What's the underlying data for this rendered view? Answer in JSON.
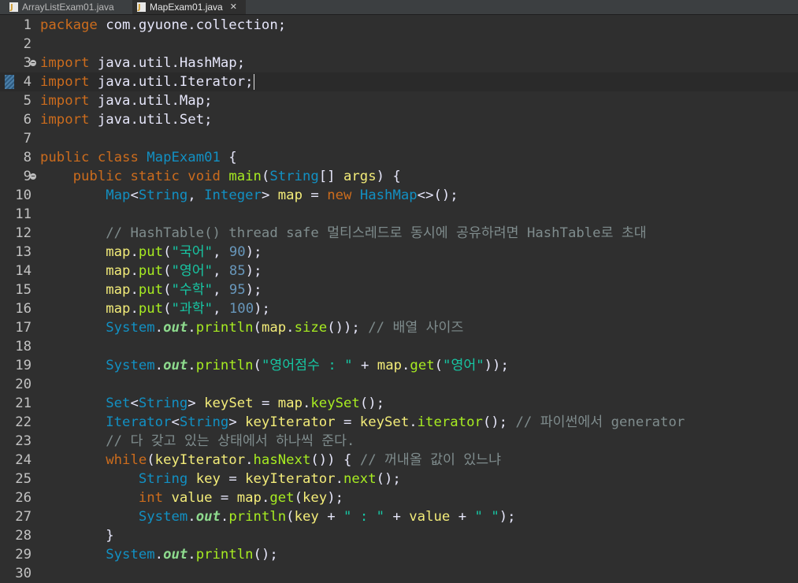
{
  "tabs": [
    {
      "label": "ArrayListExam01.java",
      "active": false
    },
    {
      "label": "MapExam01.java",
      "active": true,
      "close": "✕"
    }
  ],
  "cursor_line": 4,
  "folds": [
    3,
    9
  ],
  "lines": [
    {
      "n": "1",
      "t": [
        [
          "kw",
          "package"
        ],
        [
          "pl",
          " com.gyuone.collection;"
        ]
      ]
    },
    {
      "n": "2",
      "t": []
    },
    {
      "n": "3",
      "t": [
        [
          "kw",
          "import"
        ],
        [
          "pl",
          " java.util.HashMap;"
        ]
      ]
    },
    {
      "n": "4",
      "t": [
        [
          "kw",
          "import"
        ],
        [
          "pl",
          " java.util.Iterator;"
        ]
      ]
    },
    {
      "n": "5",
      "t": [
        [
          "kw",
          "import"
        ],
        [
          "pl",
          " java.util.Map;"
        ]
      ]
    },
    {
      "n": "6",
      "t": [
        [
          "kw",
          "import"
        ],
        [
          "pl",
          " java.util.Set;"
        ]
      ]
    },
    {
      "n": "7",
      "t": []
    },
    {
      "n": "8",
      "t": [
        [
          "kw",
          "public class "
        ],
        [
          "cls",
          "MapExam01"
        ],
        [
          "pl",
          " {"
        ]
      ]
    },
    {
      "n": "9",
      "t": [
        [
          "pl",
          "    "
        ],
        [
          "kw",
          "public static void "
        ],
        [
          "meth",
          "main"
        ],
        [
          "pl",
          "("
        ],
        [
          "ty",
          "String"
        ],
        [
          "pl",
          "[] "
        ],
        [
          "var",
          "args"
        ],
        [
          "pl",
          ") {"
        ]
      ]
    },
    {
      "n": "10",
      "t": [
        [
          "pl",
          "        "
        ],
        [
          "ty",
          "Map"
        ],
        [
          "pl",
          "<"
        ],
        [
          "ty",
          "String"
        ],
        [
          "pl",
          ", "
        ],
        [
          "ty",
          "Integer"
        ],
        [
          "pl",
          "> "
        ],
        [
          "var",
          "map"
        ],
        [
          "pl",
          " = "
        ],
        [
          "kw",
          "new "
        ],
        [
          "ty",
          "HashMap"
        ],
        [
          "pl",
          "<>();"
        ]
      ]
    },
    {
      "n": "11",
      "t": []
    },
    {
      "n": "12",
      "t": [
        [
          "pl",
          "        "
        ],
        [
          "com",
          "// HashTable() thread safe 멀티스레드로 동시에 공유하려면 HashTable로 초대"
        ]
      ]
    },
    {
      "n": "13",
      "t": [
        [
          "pl",
          "        "
        ],
        [
          "var",
          "map"
        ],
        [
          "pl",
          "."
        ],
        [
          "meth",
          "put"
        ],
        [
          "pl",
          "("
        ],
        [
          "str",
          "\"국어\""
        ],
        [
          "pl",
          ", "
        ],
        [
          "num",
          "90"
        ],
        [
          "pl",
          ");"
        ]
      ]
    },
    {
      "n": "14",
      "t": [
        [
          "pl",
          "        "
        ],
        [
          "var",
          "map"
        ],
        [
          "pl",
          "."
        ],
        [
          "meth",
          "put"
        ],
        [
          "pl",
          "("
        ],
        [
          "str",
          "\"영어\""
        ],
        [
          "pl",
          ", "
        ],
        [
          "num",
          "85"
        ],
        [
          "pl",
          ");"
        ]
      ]
    },
    {
      "n": "15",
      "t": [
        [
          "pl",
          "        "
        ],
        [
          "var",
          "map"
        ],
        [
          "pl",
          "."
        ],
        [
          "meth",
          "put"
        ],
        [
          "pl",
          "("
        ],
        [
          "str",
          "\"수학\""
        ],
        [
          "pl",
          ", "
        ],
        [
          "num",
          "95"
        ],
        [
          "pl",
          ");"
        ]
      ]
    },
    {
      "n": "16",
      "t": [
        [
          "pl",
          "        "
        ],
        [
          "var",
          "map"
        ],
        [
          "pl",
          "."
        ],
        [
          "meth",
          "put"
        ],
        [
          "pl",
          "("
        ],
        [
          "str",
          "\"과학\""
        ],
        [
          "pl",
          ", "
        ],
        [
          "num",
          "100"
        ],
        [
          "pl",
          ");"
        ]
      ]
    },
    {
      "n": "17",
      "t": [
        [
          "pl",
          "        "
        ],
        [
          "ty",
          "System"
        ],
        [
          "pl",
          "."
        ],
        [
          "sfld",
          "out"
        ],
        [
          "pl",
          "."
        ],
        [
          "meth",
          "println"
        ],
        [
          "pl",
          "("
        ],
        [
          "var",
          "map"
        ],
        [
          "pl",
          "."
        ],
        [
          "meth",
          "size"
        ],
        [
          "pl",
          "()); "
        ],
        [
          "com",
          "// 배열 사이즈"
        ]
      ]
    },
    {
      "n": "18",
      "t": []
    },
    {
      "n": "19",
      "t": [
        [
          "pl",
          "        "
        ],
        [
          "ty",
          "System"
        ],
        [
          "pl",
          "."
        ],
        [
          "sfld",
          "out"
        ],
        [
          "pl",
          "."
        ],
        [
          "meth",
          "println"
        ],
        [
          "pl",
          "("
        ],
        [
          "str",
          "\"영어점수 : \""
        ],
        [
          "pl",
          " + "
        ],
        [
          "var",
          "map"
        ],
        [
          "pl",
          "."
        ],
        [
          "meth",
          "get"
        ],
        [
          "pl",
          "("
        ],
        [
          "str",
          "\"영어\""
        ],
        [
          "pl",
          "));"
        ]
      ]
    },
    {
      "n": "20",
      "t": []
    },
    {
      "n": "21",
      "t": [
        [
          "pl",
          "        "
        ],
        [
          "ty",
          "Set"
        ],
        [
          "pl",
          "<"
        ],
        [
          "ty",
          "String"
        ],
        [
          "pl",
          "> "
        ],
        [
          "var",
          "keySet"
        ],
        [
          "pl",
          " = "
        ],
        [
          "var",
          "map"
        ],
        [
          "pl",
          "."
        ],
        [
          "meth",
          "keySet"
        ],
        [
          "pl",
          "();"
        ]
      ]
    },
    {
      "n": "22",
      "t": [
        [
          "pl",
          "        "
        ],
        [
          "ty",
          "Iterator"
        ],
        [
          "pl",
          "<"
        ],
        [
          "ty",
          "String"
        ],
        [
          "pl",
          "> "
        ],
        [
          "var",
          "keyIterator"
        ],
        [
          "pl",
          " = "
        ],
        [
          "var",
          "keySet"
        ],
        [
          "pl",
          "."
        ],
        [
          "meth",
          "iterator"
        ],
        [
          "pl",
          "(); "
        ],
        [
          "com",
          "// 파이썬에서 generator"
        ]
      ]
    },
    {
      "n": "23",
      "t": [
        [
          "pl",
          "        "
        ],
        [
          "com",
          "// 다 갖고 있는 상태에서 하나씩 준다."
        ]
      ]
    },
    {
      "n": "24",
      "t": [
        [
          "pl",
          "        "
        ],
        [
          "kw",
          "while"
        ],
        [
          "pl",
          "("
        ],
        [
          "var",
          "keyIterator"
        ],
        [
          "pl",
          "."
        ],
        [
          "meth",
          "hasNext"
        ],
        [
          "pl",
          "()) { "
        ],
        [
          "com",
          "// 꺼내올 값이 있느냐"
        ]
      ]
    },
    {
      "n": "25",
      "t": [
        [
          "pl",
          "            "
        ],
        [
          "ty",
          "String"
        ],
        [
          "pl",
          " "
        ],
        [
          "var",
          "key"
        ],
        [
          "pl",
          " = "
        ],
        [
          "var",
          "keyIterator"
        ],
        [
          "pl",
          "."
        ],
        [
          "meth",
          "next"
        ],
        [
          "pl",
          "();"
        ]
      ]
    },
    {
      "n": "26",
      "t": [
        [
          "pl",
          "            "
        ],
        [
          "kw",
          "int "
        ],
        [
          "var",
          "value"
        ],
        [
          "pl",
          " = "
        ],
        [
          "var",
          "map"
        ],
        [
          "pl",
          "."
        ],
        [
          "meth",
          "get"
        ],
        [
          "pl",
          "("
        ],
        [
          "var",
          "key"
        ],
        [
          "pl",
          ");"
        ]
      ]
    },
    {
      "n": "27",
      "t": [
        [
          "pl",
          "            "
        ],
        [
          "ty",
          "System"
        ],
        [
          "pl",
          "."
        ],
        [
          "sfld",
          "out"
        ],
        [
          "pl",
          "."
        ],
        [
          "meth",
          "println"
        ],
        [
          "pl",
          "("
        ],
        [
          "var",
          "key"
        ],
        [
          "pl",
          " + "
        ],
        [
          "str",
          "\" : \""
        ],
        [
          "pl",
          " + "
        ],
        [
          "var",
          "value"
        ],
        [
          "pl",
          " + "
        ],
        [
          "str",
          "\" \""
        ],
        [
          "pl",
          ");"
        ]
      ]
    },
    {
      "n": "28",
      "t": [
        [
          "pl",
          "        }"
        ]
      ]
    },
    {
      "n": "29",
      "t": [
        [
          "pl",
          "        "
        ],
        [
          "ty",
          "System"
        ],
        [
          "pl",
          "."
        ],
        [
          "sfld",
          "out"
        ],
        [
          "pl",
          "."
        ],
        [
          "meth",
          "println"
        ],
        [
          "pl",
          "();"
        ]
      ]
    },
    {
      "n": "30",
      "t": []
    }
  ]
}
